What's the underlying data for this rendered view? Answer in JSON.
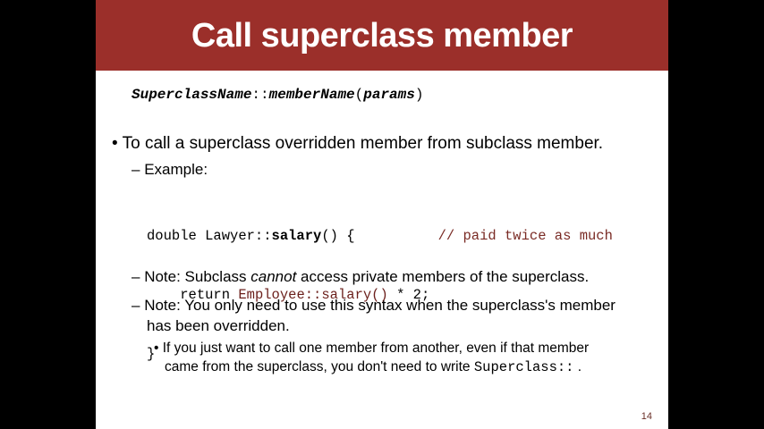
{
  "slide": {
    "title": "Call superclass member",
    "syntax": {
      "class_part": "SuperclassName",
      "sep": "::",
      "member_part": "memberName",
      "open": "(",
      "params": "params",
      "close": ")"
    },
    "bullet_main": "To call a superclass overridden member from subclass member.",
    "example_label": "Example:",
    "code": {
      "line1_a": "double Lawyer::",
      "line1_b": "salary",
      "line1_c": "() {",
      "line1_comment": "// paid twice as much",
      "line2_a": "return ",
      "line2_b": "Employee::salary()",
      "line2_c": " * 2;",
      "line3": "}"
    },
    "note1_a": "Note: Subclass ",
    "note1_b": "cannot",
    "note1_c": " access private members of the superclass.",
    "note2_line1": "Note: You only need to use this syntax when the superclass's member",
    "note2_line2": "has been overridden.",
    "sub_line1": "If you just want to call one member from another, even if that member",
    "sub_line2_a": "came from the superclass, you don't need to write ",
    "sub_line2_b": "Superclass::",
    "sub_line2_c": " .",
    "page_number": "14"
  }
}
